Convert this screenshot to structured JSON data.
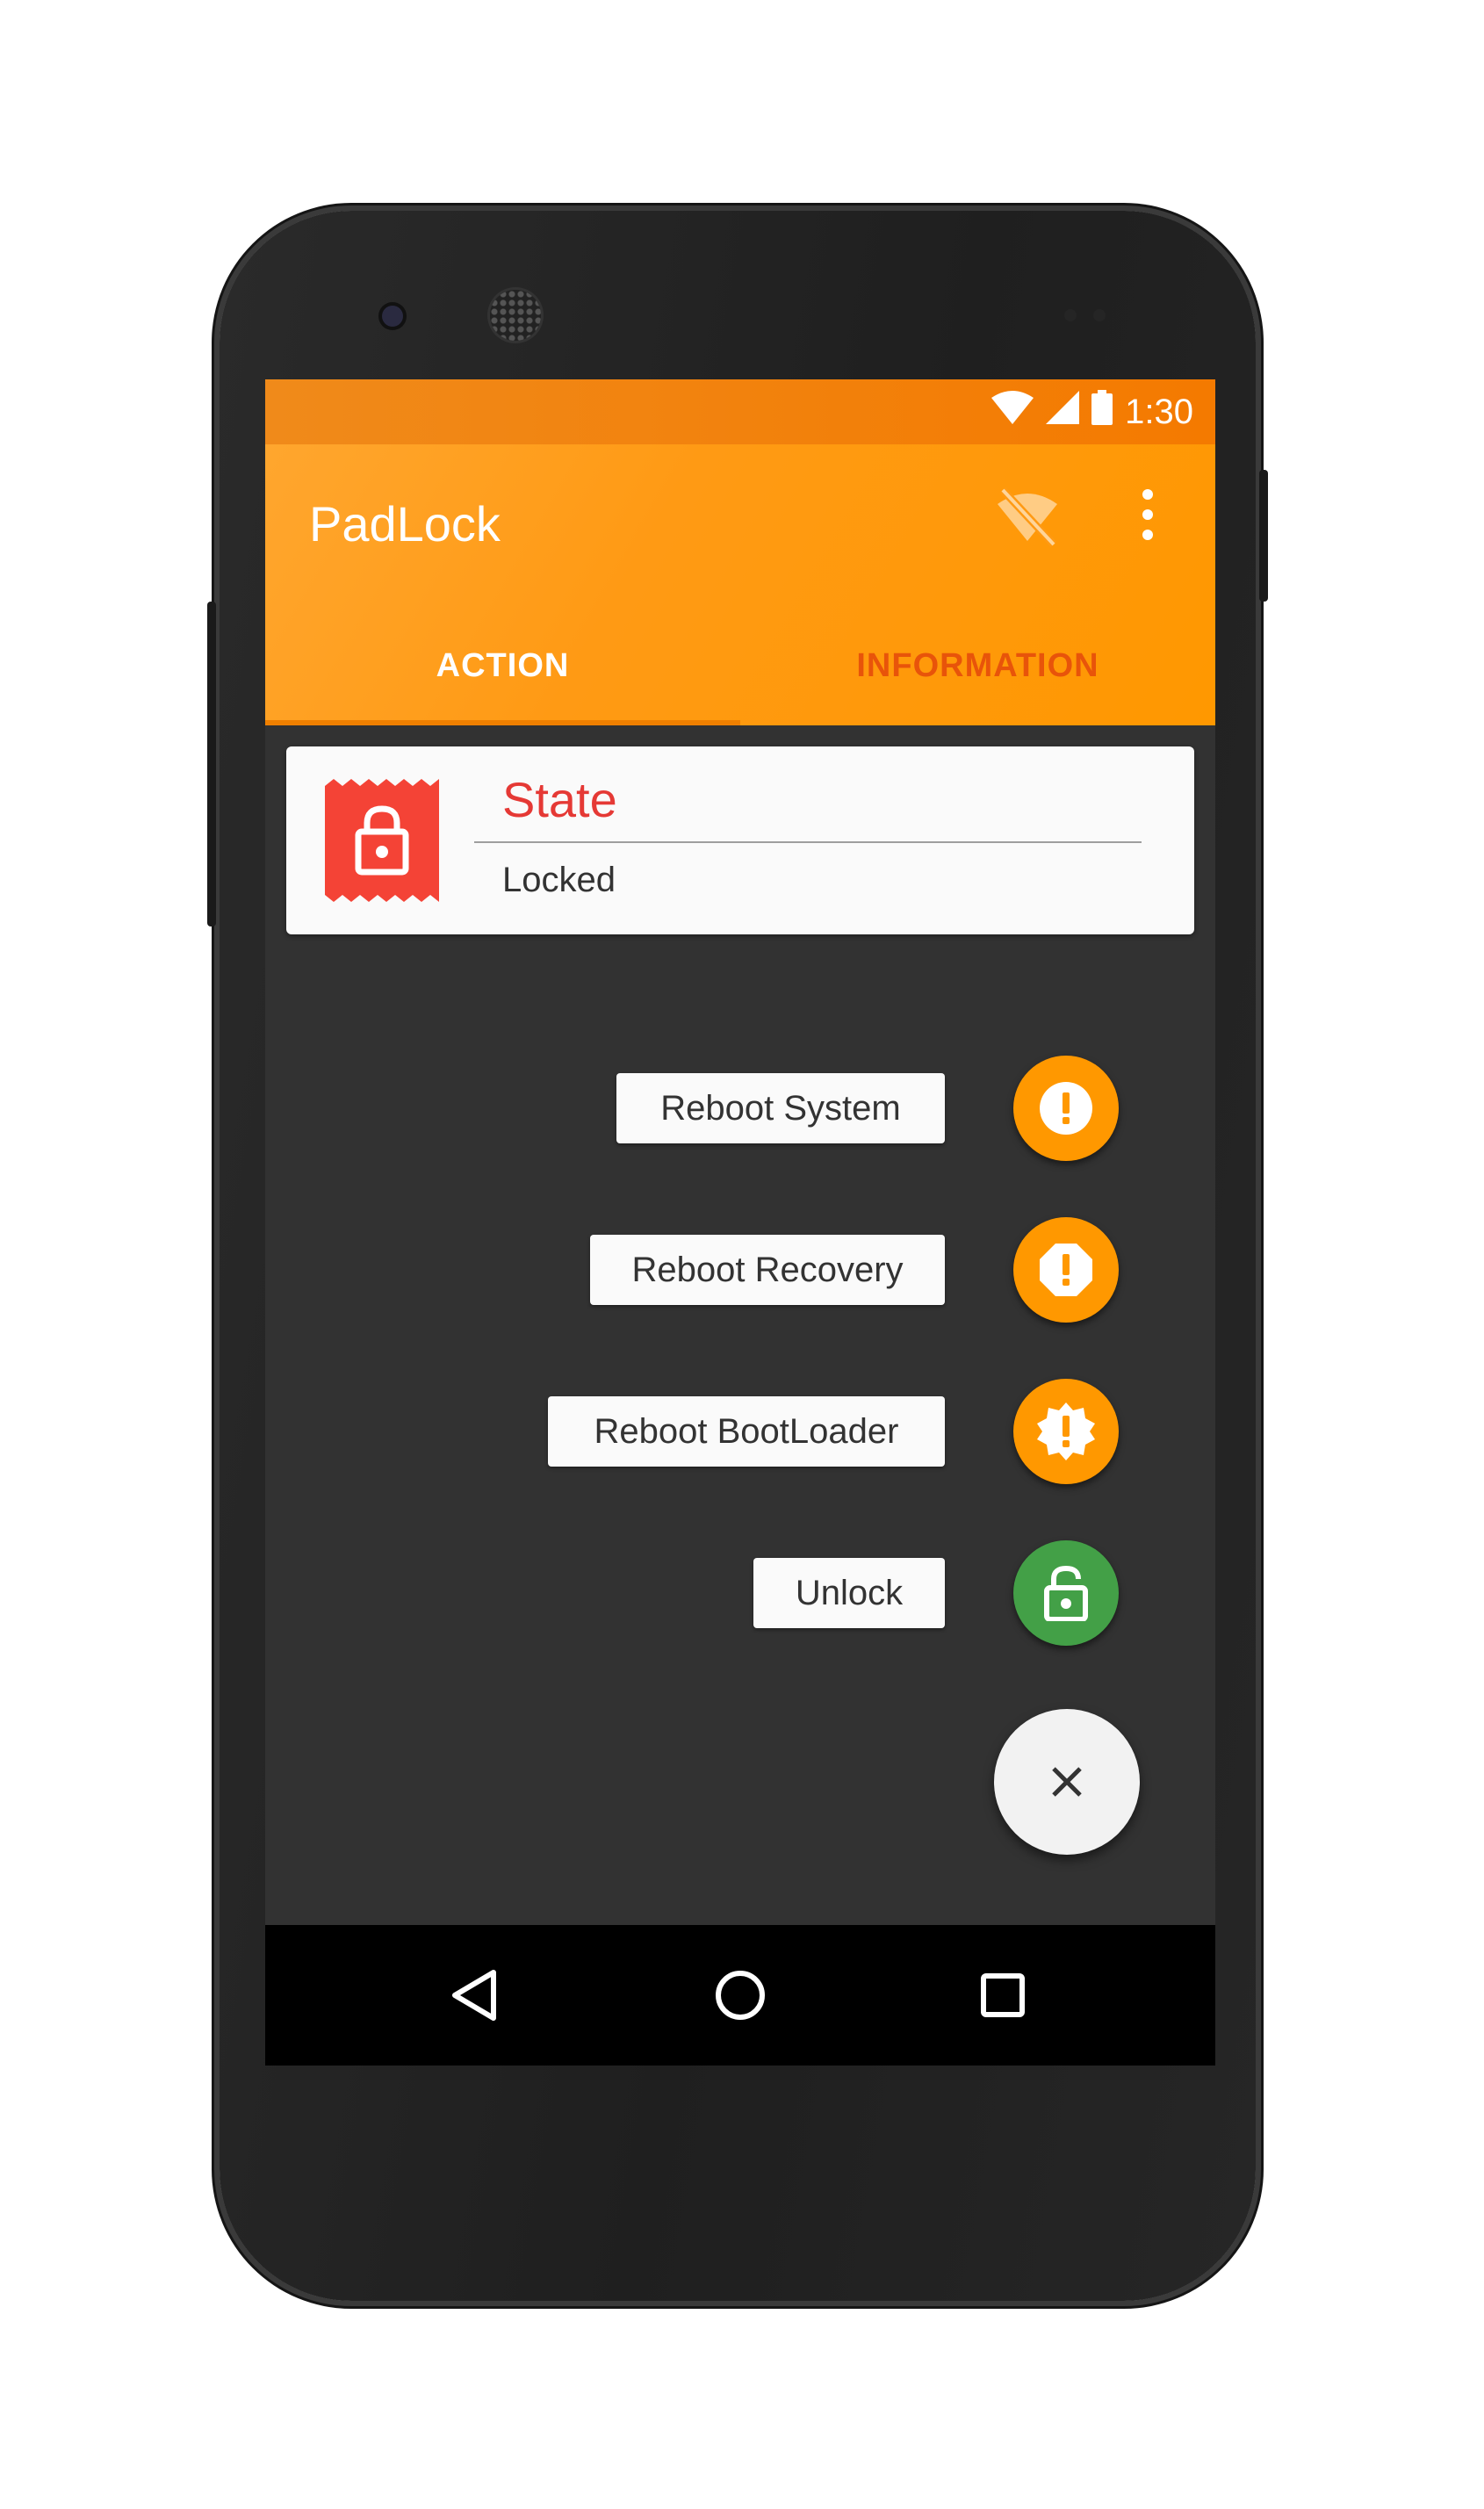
{
  "status_bar": {
    "time": "1:30"
  },
  "app_bar": {
    "title": "PadLock"
  },
  "tabs": [
    {
      "label": "ACTION",
      "selected": true
    },
    {
      "label": "INFORMATION",
      "selected": false
    }
  ],
  "state_card": {
    "title": "State",
    "value": "Locked",
    "icon": "lock-ticket-icon"
  },
  "fab_menu": {
    "items": [
      {
        "label": "Reboot System",
        "icon": "alert-circle-icon"
      },
      {
        "label": "Reboot Recovery",
        "icon": "alert-octagon-icon"
      },
      {
        "label": "Reboot BootLoader",
        "icon": "alert-decagram-icon"
      },
      {
        "label": "Unlock",
        "icon": "lock-open-icon"
      }
    ],
    "close_icon": "close-icon"
  },
  "colors": {
    "primary": "#ff9800",
    "status_bar": "#f47a00",
    "accent_orange": "#ff9800",
    "unlock_green": "#43a047",
    "state_red": "#e53935",
    "background": "#323232"
  }
}
